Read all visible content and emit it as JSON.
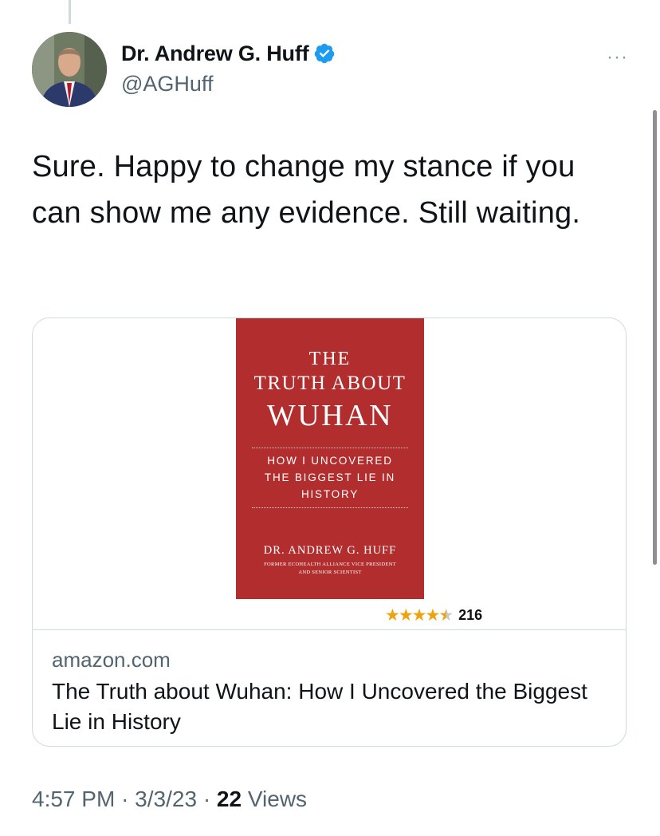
{
  "author": {
    "display_name": "Dr. Andrew G. Huff",
    "handle": "@AGHuff",
    "verified": true,
    "avatar_icon": "profile-photo"
  },
  "more_label": "···",
  "tweet": {
    "text": "Sure. Happy to change my stance if you can show me any evidence. Still waiting."
  },
  "card": {
    "cover": {
      "line1": "THE",
      "line2": "TRUTH ABOUT",
      "line3": "WUHAN",
      "subtitle_line1": "HOW I UNCOVERED",
      "subtitle_line2": "THE BIGGEST LIE IN",
      "subtitle_line3": "HISTORY",
      "author": "DR. ANDREW G. HUFF",
      "tagline_line1": "FORMER ECOHEALTH ALLIANCE VICE PRESIDENT",
      "tagline_line2": "AND SENIOR SCIENTIST",
      "color": "#b22e2e"
    },
    "rating": {
      "stars": 4.5,
      "count": "216",
      "star_color": "#f0a20e"
    },
    "domain": "amazon.com",
    "title": "The Truth about Wuhan: How I Uncovered the Biggest Lie in History"
  },
  "footer": {
    "time": "4:57 PM",
    "separator": "·",
    "date": "3/3/23",
    "views_count": "22",
    "views_label": "Views"
  },
  "colors": {
    "text_primary": "#0f1419",
    "text_secondary": "#536471",
    "border": "#cfd9de",
    "verified_blue": "#1d9bf0"
  }
}
